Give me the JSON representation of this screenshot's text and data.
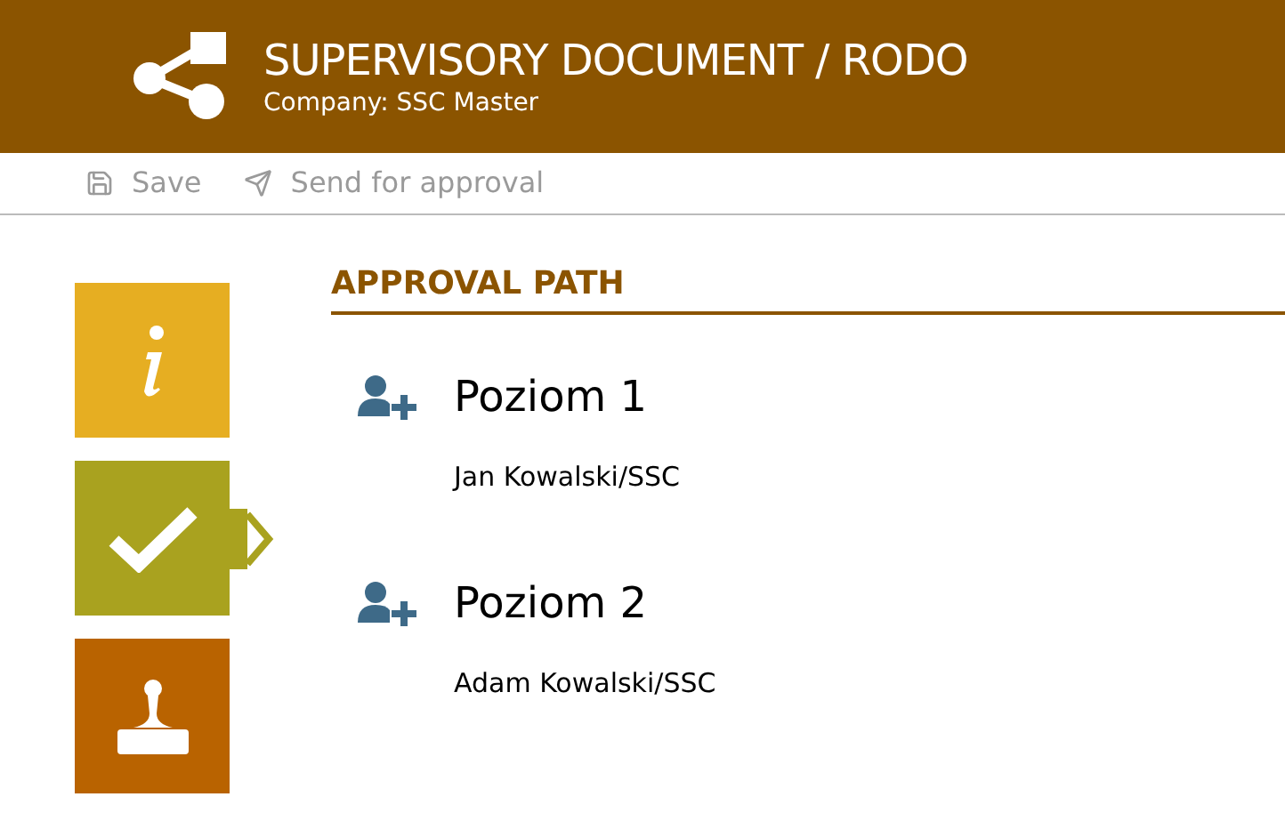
{
  "header": {
    "title": "SUPERVISORY DOCUMENT / RODO",
    "subtitle": "Company: SSC Master"
  },
  "toolbar": [
    {
      "kind": "save",
      "label": "Save",
      "disabled": true
    },
    {
      "kind": "send",
      "label": "Send for approval",
      "disabled": true
    }
  ],
  "side_tabs": [
    {
      "kind": "info",
      "color": "#e6ae22",
      "selected": false
    },
    {
      "kind": "approval",
      "color": "#a9a21f",
      "selected": true
    },
    {
      "kind": "stamp",
      "color": "#b96300",
      "selected": false
    }
  ],
  "section": {
    "title": "APPROVAL PATH"
  },
  "levels": [
    {
      "title": "Poziom 1",
      "approver": "Jan Kowalski/SSC"
    },
    {
      "title": "Poziom 2",
      "approver": "Adam Kowalski/SSC"
    }
  ]
}
